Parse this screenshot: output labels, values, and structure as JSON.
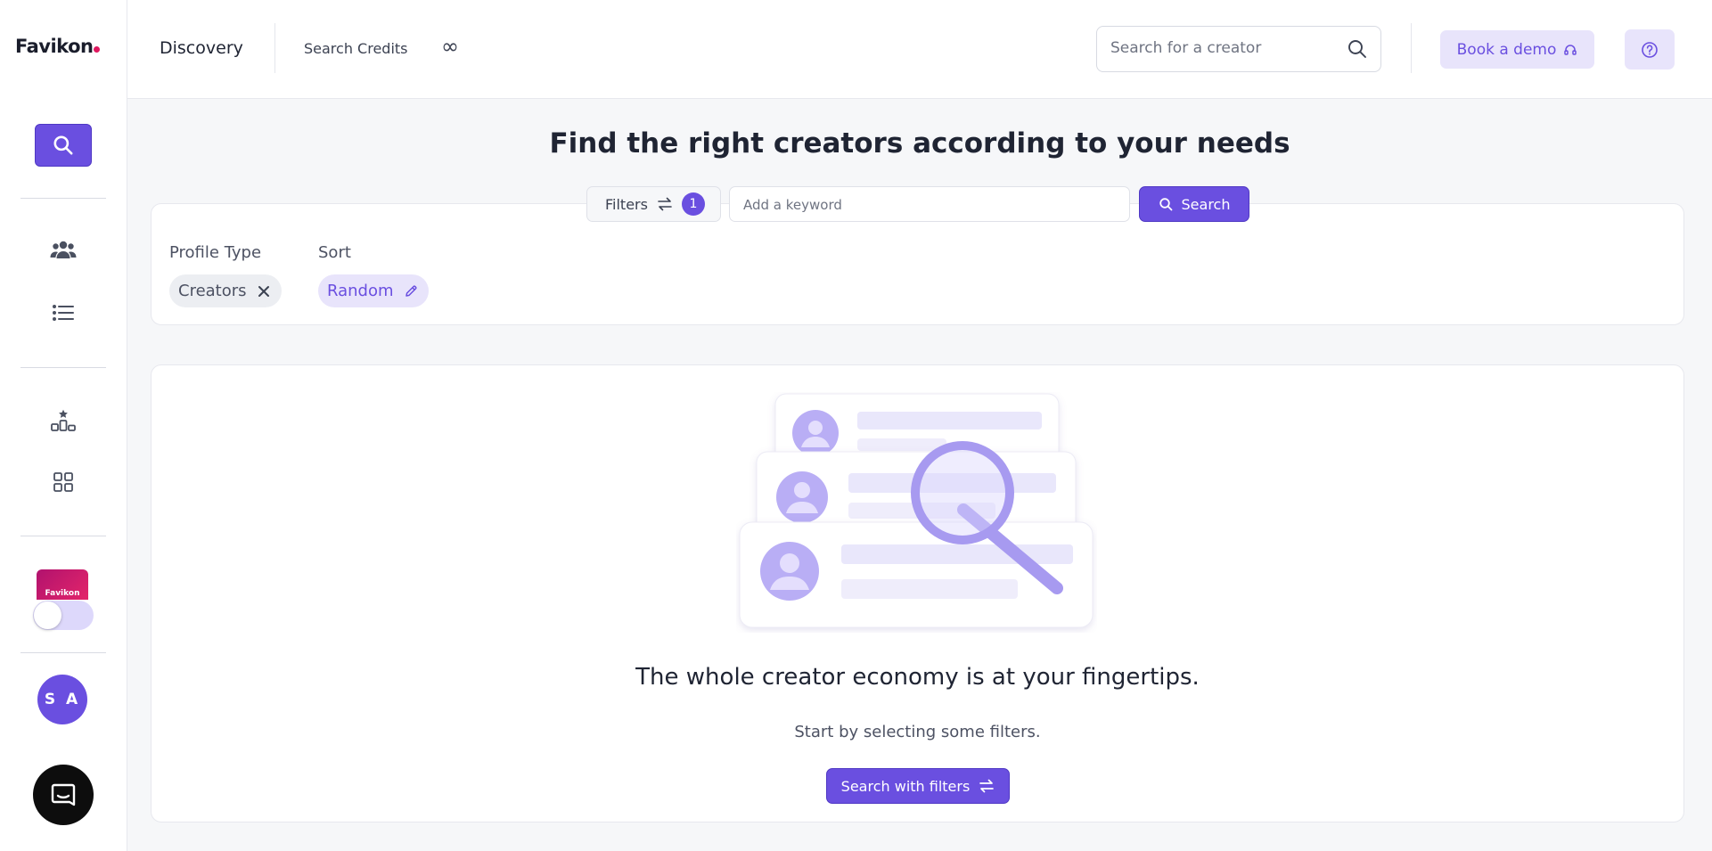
{
  "brand": {
    "name": "Favikon",
    "accent": "#6a4fe0",
    "dot_color": "#e0185f"
  },
  "sidebar": {
    "items": [
      {
        "name": "search-icon"
      },
      {
        "name": "people-icon"
      },
      {
        "name": "list-icon"
      },
      {
        "name": "ranking-icon"
      },
      {
        "name": "grid-icon"
      }
    ],
    "brand_thumb_label": "Favikon",
    "avatar_initials": "S A",
    "chat_icon": "chat-icon"
  },
  "header": {
    "title": "Discovery",
    "credits_label": "Search Credits",
    "credits_value": "∞",
    "search_placeholder": "Search for a creator",
    "demo_label": "Book a demo",
    "help_icon": "help-icon"
  },
  "main": {
    "title": "Find the right creators according to your needs",
    "filters_label": "Filters",
    "filters_count": "1",
    "keyword_placeholder": "Add a keyword",
    "search_label": "Search",
    "profile_type_label": "Profile Type",
    "profile_type_value": "Creators",
    "sort_label": "Sort",
    "sort_value": "Random"
  },
  "empty_state": {
    "title": "The whole creator economy is at your fingertips.",
    "subtitle": "Start by selecting some filters.",
    "button_label": "Search with filters"
  }
}
